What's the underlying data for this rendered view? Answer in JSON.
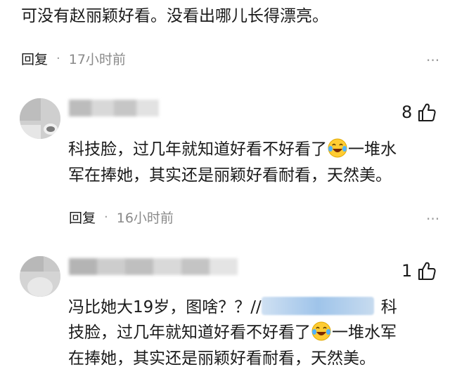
{
  "comments": [
    {
      "text": "可没有赵丽颖好看。没看出哪儿长得漂亮。",
      "reply_label": "回复",
      "time": "17小时前"
    },
    {
      "likes": "8",
      "text_line1a": "科技脸，过几年就知道好看不好看了",
      "text_line1b": "一堆水",
      "text_line2": "军在捧她，其实还是丽颖好看耐看，天然美。",
      "reply_label": "回复",
      "time": "16小时前"
    },
    {
      "likes": "1",
      "text_line1a": "冯比她大19岁，图啥？？//",
      "text_line1b": "科",
      "text_line2a": "技脸，过几年就知道好看不好看了",
      "text_line2b": "一堆水军",
      "text_line3": "在捧她，其实还是丽颖好看耐看，天然美。"
    }
  ],
  "icons": {
    "like": "thumbs-up-icon",
    "more": "more-dots-icon",
    "emoji": "laughing-crying-emoji"
  },
  "colors": {
    "text": "#1a1a1a",
    "muted": "#8a8a8a",
    "link_mask": "#9fc4ea"
  }
}
